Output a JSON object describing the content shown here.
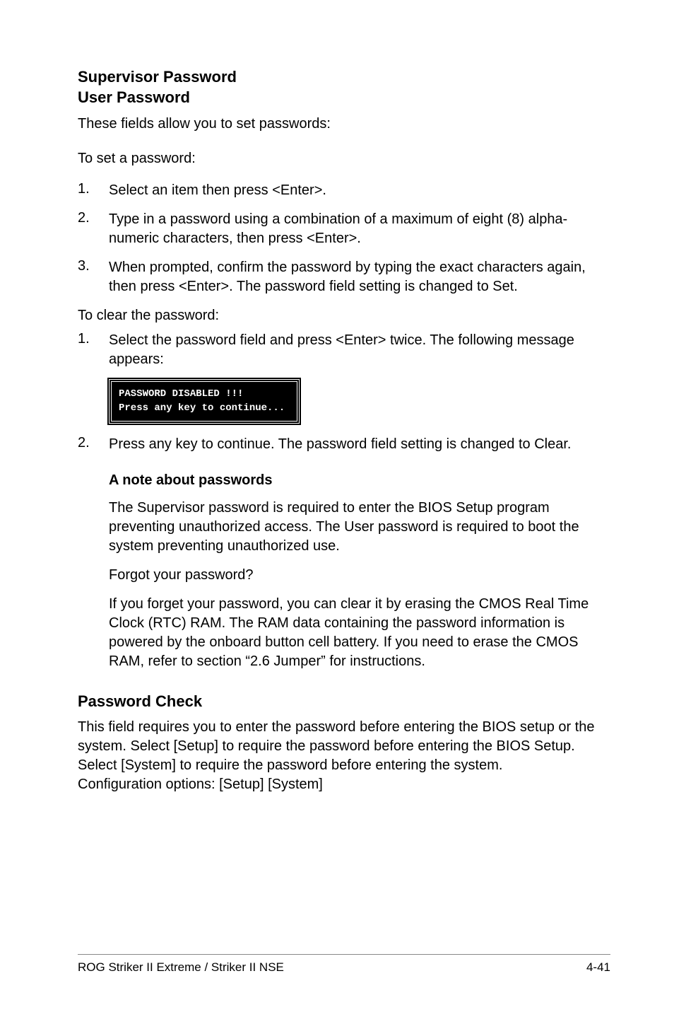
{
  "header": {
    "title_line1": "Supervisor Password",
    "title_line2": "User Password"
  },
  "intro1": "These fields allow you to set passwords:",
  "intro2": "To set a password:",
  "list1": [
    {
      "num": "1.",
      "text": "Select an item then press <Enter>."
    },
    {
      "num": "2.",
      "text": "Type in a password using a combination of a maximum of eight (8) alpha-numeric characters, then press <Enter>."
    },
    {
      "num": "3.",
      "text": "When prompted, confirm the password by typing the exact characters again, then press <Enter>. The password field setting is changed to Set."
    }
  ],
  "intro3": "To clear the password:",
  "list2a": {
    "num": "1.",
    "text": "Select the password field and press <Enter> twice. The following message appears:"
  },
  "codebox": "PASSWORD DISABLED !!!\nPress any key to continue...",
  "list2b": {
    "num": "2.",
    "text": "Press any key to continue. The password field setting is changed to Clear."
  },
  "note": {
    "heading": "A note about passwords",
    "p1": "The Supervisor password is required to enter the BIOS Setup program preventing unauthorized access. The User password is required to boot the system preventing unauthorized use.",
    "p2": "Forgot your password?",
    "p3": "If you forget your password, you can clear it by erasing the CMOS Real Time Clock (RTC) RAM. The RAM data containing the password information is powered by the onboard button cell battery. If you need to erase the CMOS RAM, refer to section “2.6 Jumper” for instructions."
  },
  "section2": {
    "heading": "Password Check",
    "body": "This field requires you to enter the password before entering the BIOS setup or the system. Select [Setup] to require the password before entering the BIOS Setup. Select [System] to require the password before entering the system.\nConfiguration options: [Setup] [System]"
  },
  "footer": {
    "left": "ROG Striker II Extreme / Striker II NSE",
    "right": "4-41"
  }
}
